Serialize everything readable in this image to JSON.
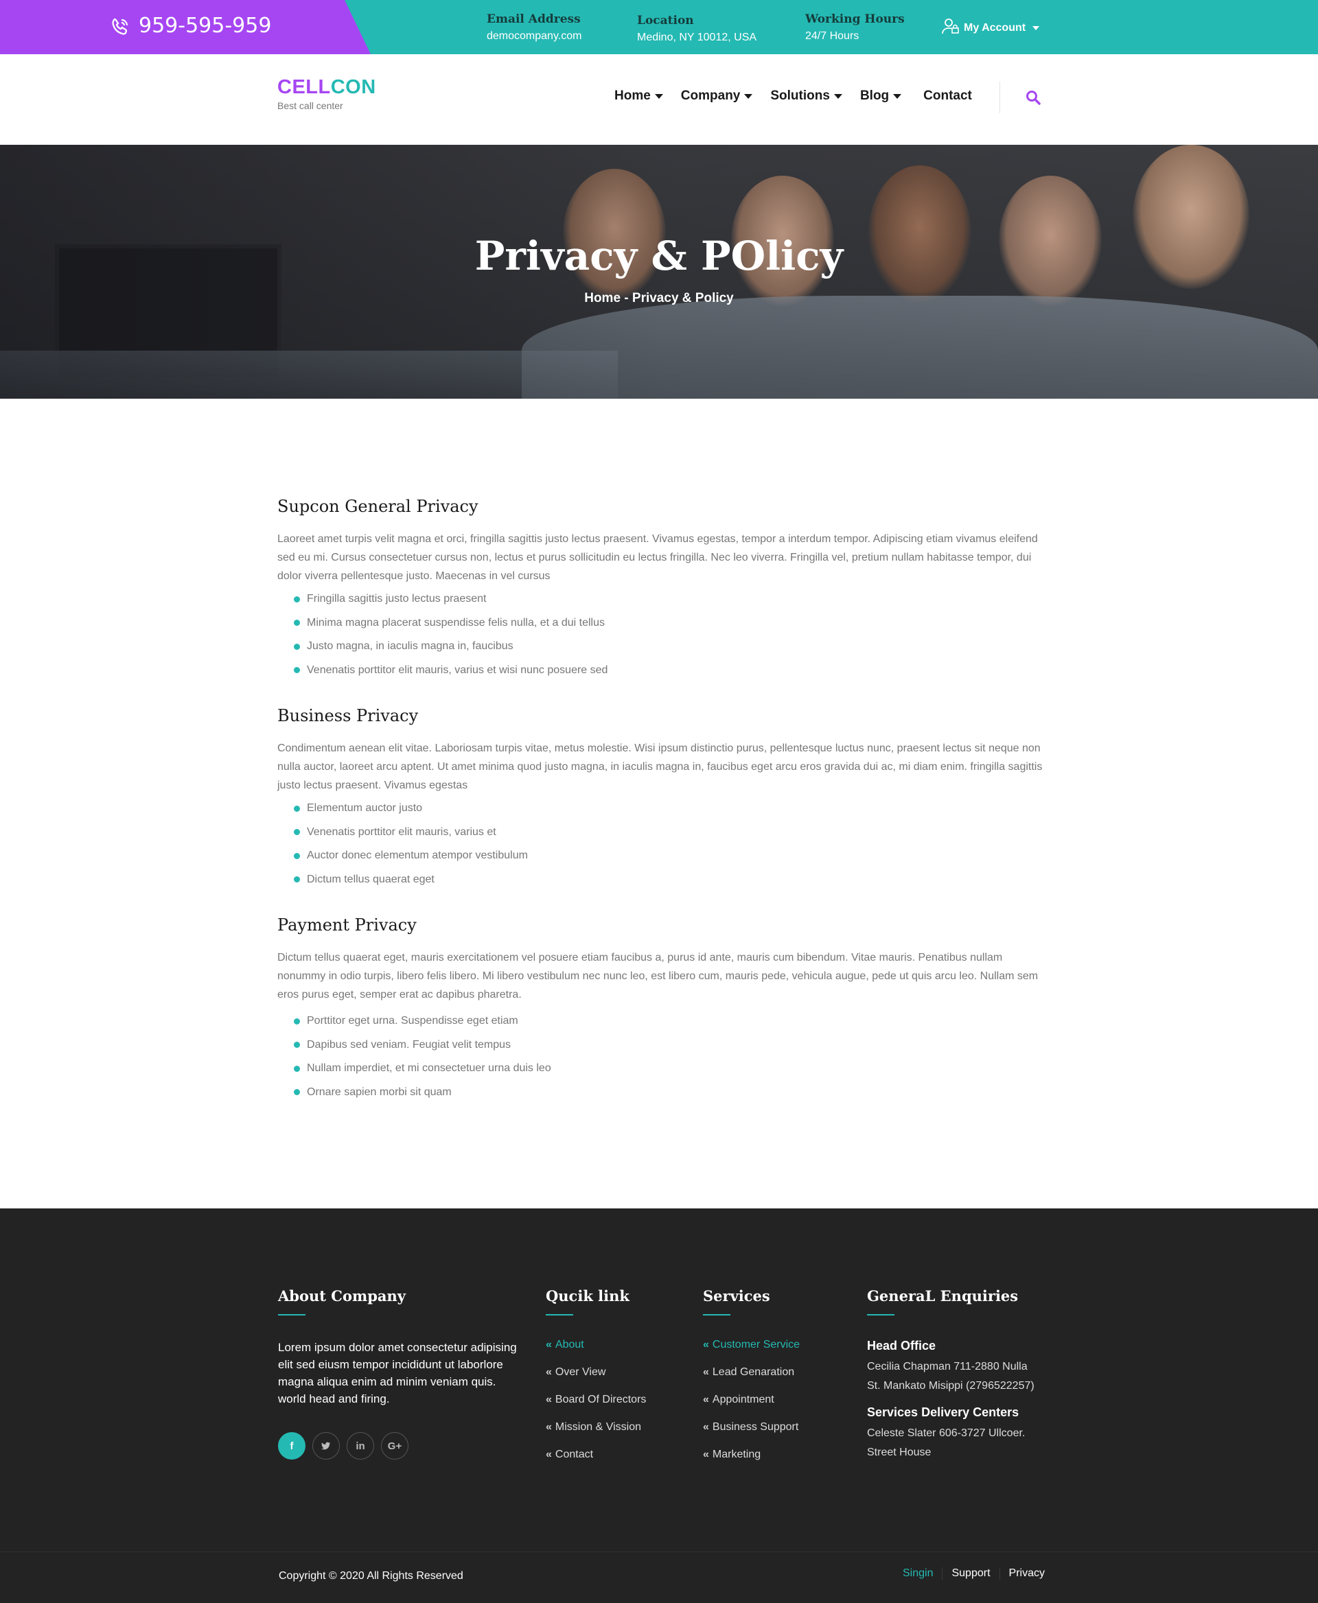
{
  "topbar": {
    "phone": "959-595-959",
    "email_label": "Email Address",
    "email_value": "democompany.com",
    "location_label": "Location",
    "location_value": "Medino, NY 10012, USA",
    "hours_label": "Working Hours",
    "hours_value": "24/7 Hours",
    "account_label": "My Account"
  },
  "header": {
    "logo_part1": "CELL",
    "logo_part2": "CON",
    "tagline": "Best call center",
    "nav": [
      {
        "label": "Home"
      },
      {
        "label": "Company"
      },
      {
        "label": "Solutions"
      },
      {
        "label": "Blog"
      },
      {
        "label": "Contact"
      }
    ]
  },
  "hero": {
    "title": "Privacy & POlicy",
    "breadcrumb": "Home - Privacy & Policy"
  },
  "sections": [
    {
      "title": "Supcon General Privacy",
      "text": "Laoreet amet turpis velit magna et orci, fringilla sagittis justo lectus praesent. Vivamus egestas, tempor a interdum tempor. Adipiscing etiam vivamus eleifend sed eu mi. Cursus consectetuer cursus non, lectus et purus sollicitudin eu lectus fringilla. Nec leo viverra. Fringilla vel, pretium nullam habitasse tempor, dui dolor viverra pellentesque justo. Maecenas in vel cursus",
      "bullets": [
        "Fringilla sagittis justo lectus praesent",
        "Minima magna placerat suspendisse felis nulla, et a dui tellus",
        "Justo magna, in iaculis magna in, faucibus",
        "Venenatis porttitor elit mauris, varius et wisi nunc posuere sed"
      ]
    },
    {
      "title": "Business  Privacy",
      "text": "Condimentum aenean elit vitae. Laboriosam turpis vitae, metus molestie. Wisi ipsum distinctio purus, pellentesque luctus nunc, praesent lectus sit neque non nulla auctor, laoreet arcu aptent. Ut amet minima quod justo magna, in iaculis magna in, faucibus eget arcu eros gravida dui ac, mi diam enim. fringilla sagittis justo lectus praesent. Vivamus egestas",
      "bullets": [
        "Elementum auctor justo",
        "Venenatis porttitor elit mauris, varius et",
        "Auctor donec elementum atempor vestibulum",
        "Dictum tellus quaerat eget"
      ]
    },
    {
      "title": "Payment  Privacy",
      "text": "Dictum tellus quaerat eget, mauris exercitationem vel posuere etiam faucibus a, purus id ante, mauris cum bibendum. Vitae mauris. Penatibus nullam nonummy in odio turpis, libero felis libero. Mi libero vestibulum nec nunc leo, est libero cum, mauris pede, vehicula augue, pede ut quis arcu leo. Nullam sem eros purus eget, semper erat ac dapibus pharetra.",
      "bullets": [
        "Porttitor eget urna. Suspendisse eget etiam",
        "Dapibus sed veniam. Feugiat velit tempus",
        "Nullam imperdiet, et mi consectetuer urna duis leo",
        " Ornare sapien morbi sit quam"
      ]
    }
  ],
  "footer": {
    "about_title": "About Company",
    "about_text": "Lorem ipsum dolor amet consectetur adipising elit sed eiusm tempor incididunt ut laborlore magna aliqua enim ad minim veniam quis. world head and firing.",
    "social": [
      "f",
      "t",
      "in",
      "G+"
    ],
    "quick_title": "Qucik link",
    "quick_links": [
      "About",
      "Over View",
      "Board Of Directors",
      "Mission & Vission",
      "Contact"
    ],
    "services_title": "Services",
    "services": [
      "Customer Service",
      "Lead Genaration",
      "Appointment",
      "Business Support",
      "Marketing"
    ],
    "enq_title": "GeneraL Enquiries",
    "head_office_label": "Head Office",
    "head_office_addr1": "Cecilia Chapman 711-2880 Nulla",
    "head_office_addr2": "St. Mankato Misippi (2796522257)",
    "delivery_label": "Services Delivery Centers",
    "delivery_addr1": "Celeste Slater 606-3727 Ullcoer.",
    "delivery_addr2": "Street House",
    "copyright": "Copyright © 2020 All Rights Reserved",
    "bottom_links": [
      "Singin",
      "Support",
      "Privacy"
    ]
  },
  "colors": {
    "accent_teal": "#25b9b3",
    "accent_purple": "#a646f2",
    "footer_bg": "#232323"
  }
}
